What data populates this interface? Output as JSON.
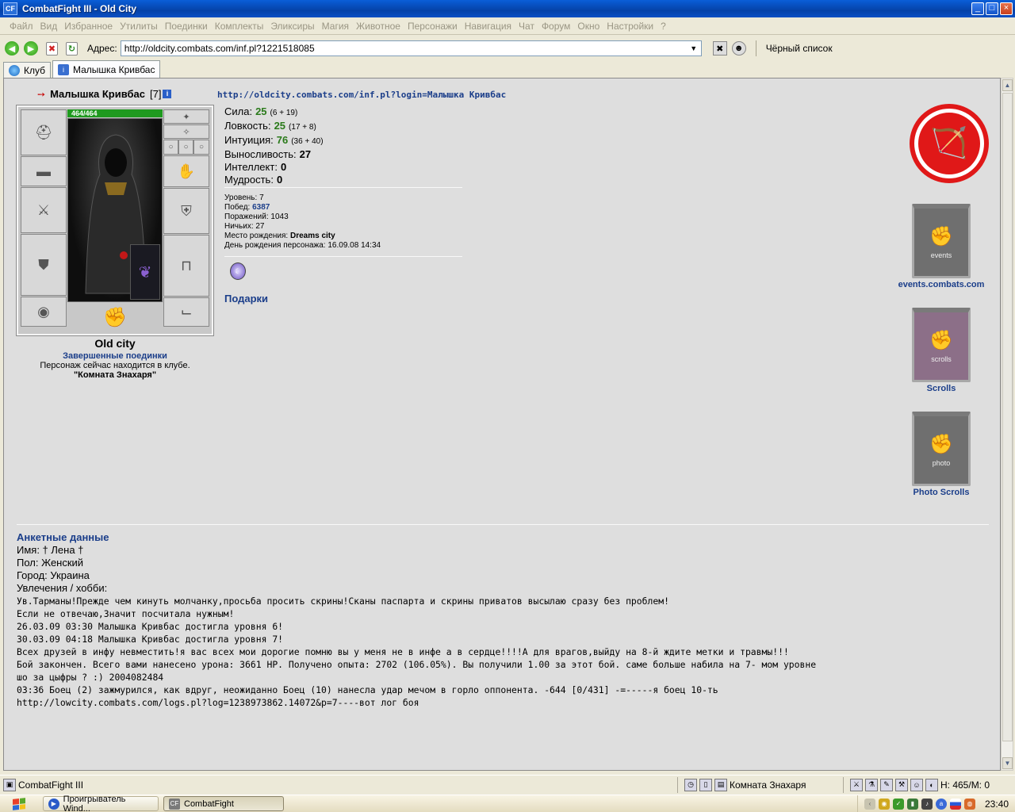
{
  "window": {
    "title": "CombatFight III - Old City",
    "app_icon": "CF"
  },
  "menu": [
    "Файл",
    "Вид",
    "Избранное",
    "Утилиты",
    "Поединки",
    "Комплекты",
    "Эликсиры",
    "Магия",
    "Животное",
    "Персонажи",
    "Навигация",
    "Чат",
    "Форум",
    "Окно",
    "Настройки",
    "?"
  ],
  "address_bar": {
    "label": "Адрес:",
    "url": "http://oldcity.combats.com/inf.pl?1221518085",
    "blacklist": "Чёрный список"
  },
  "tabs": [
    {
      "label": "Клуб",
      "icon": "globe-icon"
    },
    {
      "label": "Малышка Кривбас",
      "icon": "info-icon"
    }
  ],
  "character": {
    "nick": "Малышка Кривбас",
    "level": "[7]",
    "info_link": "http://oldcity.combats.com/inf.pl?login=Малышка Кривбас",
    "hp": "464/464",
    "city": "Old city",
    "fights_link": "Завершенные поединки",
    "location_text": "Персонаж сейчас находится в клубе.",
    "room": "\"Комната Знахаря\""
  },
  "stats": [
    {
      "label": "Сила:",
      "value": "25",
      "sub": "(6 + 19)",
      "green": true
    },
    {
      "label": "Ловкость:",
      "value": "25",
      "sub": "(17 + 8)",
      "green": true
    },
    {
      "label": "Интуиция:",
      "value": "76",
      "sub": "(36 + 40)",
      "green": true
    },
    {
      "label": "Выносливость:",
      "value": "27",
      "sub": "",
      "green": false
    },
    {
      "label": "Интеллект:",
      "value": "0",
      "sub": "",
      "green": false
    },
    {
      "label": "Мудрость:",
      "value": "0",
      "sub": "",
      "green": false
    }
  ],
  "info": {
    "level_label": "Уровень:",
    "level": "7",
    "wins_label": "Побед:",
    "wins": "6387",
    "losses_label": "Поражений:",
    "losses": "1043",
    "draws_label": "Ничьих:",
    "draws": "27",
    "birthplace_label": "Место рождения:",
    "birthplace": "Dreams city",
    "birthday_label": "День рождения персонажа:",
    "birthday": "16.09.08 14:34"
  },
  "gifts": "Подарки",
  "banners": {
    "events": {
      "tag": "events",
      "label": "events.combats.com"
    },
    "scrolls": {
      "tag": "scrolls",
      "label": "Scrolls"
    },
    "photo": {
      "tag": "photo",
      "label": "Photo Scrolls"
    }
  },
  "profile": {
    "header": "Анкетные данные",
    "name_line": "Имя: † Лена †",
    "gender_line": "Пол: Женский",
    "city_line": "Город: Украина",
    "hobby_label": "Увлечения / хобби:",
    "hobby_lines": [
      "Ув.Тарманы!Прежде чем кинуть молчанку,просьба просить скрины!Сканы паспарта и скрины приватов высылаю сразу без проблем!",
      "Если не отвечаю,Значит посчитала нужным!",
      "26.03.09 03:30 Малышка Кривбас достигла уровня 6!",
      "30.03.09 04:18 Малышка Кривбас достигла уровня 7!",
      "",
      "Всех друзей в инфу невместить!я вас всех мои дорогие помню вы у меня не в инфе а в сердце!!!!А для врагов,выйду на 8-й ждите метки и травмы!!!",
      "",
      "Бой закончен. Всего вами нанесено урона: 3661 HP. Получено опыта: 2702 (106.05%). Вы получили 1.00 за этот бой. саме больше набила на 7- мом уровне",
      "",
      "шо за цыфры ? :) 2004082484",
      "",
      "",
      "03:36 Боец (2) зажмурился, как вдруг, неожиданно Боец (10) нанесла удар мечом в горло оппонента. -644 [0/431] -=-----я боец 10-ть",
      "http://lowcity.combats.com/logs.pl?log=1238973862.14072&p=7----вот лог боя"
    ]
  },
  "statusbar": {
    "app": "CombatFight III",
    "room": "Комната Знахаря",
    "hp": "Н: 465/М: 0"
  },
  "taskbar": {
    "task1": "Проигрыватель Wind...",
    "task2": "CombatFight",
    "clock": "23:40"
  }
}
